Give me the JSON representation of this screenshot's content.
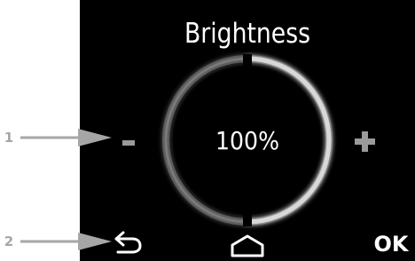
{
  "screen": {
    "title": "Brightness",
    "value_text": "100%",
    "brightness_percent": 100,
    "decrease_symbol": "-",
    "increase_symbol": "+",
    "confirm_label": "OK"
  },
  "callouts": [
    {
      "label": "1"
    },
    {
      "label": "2"
    }
  ],
  "colors": {
    "screen_background": "#000000",
    "ring_track": "#6e6e6e",
    "ring_highlight": "#d8d8d8",
    "text": "#ffffff",
    "control_gray": "#9a9a9a",
    "callout_gray": "#a6a6a6"
  },
  "icons": {
    "decrease": "minus-icon",
    "increase": "plus-icon",
    "back": "back-arrow-icon",
    "home": "home-icon"
  }
}
